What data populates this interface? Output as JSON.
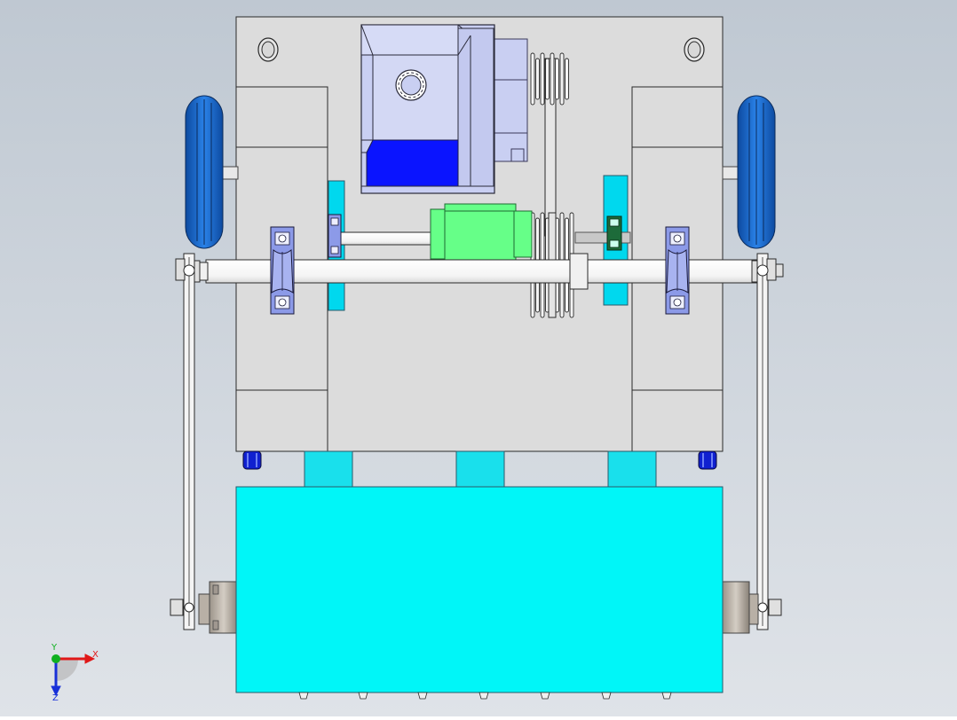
{
  "viewport": {
    "background_top": "#bfc8d2",
    "background_bottom": "#dfe3e8"
  },
  "colors": {
    "frame": "#dcdcdc",
    "frame_stroke": "#2a2a2a",
    "hopper": "#00f6f8",
    "tab": "#19e0ec",
    "post": "#00d8ee",
    "shaft": "#ffffff",
    "coupling": "#66ff88",
    "motor_body": "#c9cff2",
    "motor_face": "#0a14ff",
    "motor_dark": "#a9b0e8",
    "bearing": "#8c9ae8",
    "wheel": "#1e6ed6",
    "wheel_dark": "#0f4fa8",
    "pulley": "#f1f1f1",
    "bracket_green": "#1d6b3a",
    "sleeve": "#c9c2b9",
    "caster": "#1020d0"
  },
  "triad": {
    "icon": "coordinate-triad-icon",
    "x_label": "X",
    "y_label": "Y",
    "z_label": "Z",
    "x_color": "#e01818",
    "y_color": "#10b020",
    "z_color": "#1830d8"
  }
}
